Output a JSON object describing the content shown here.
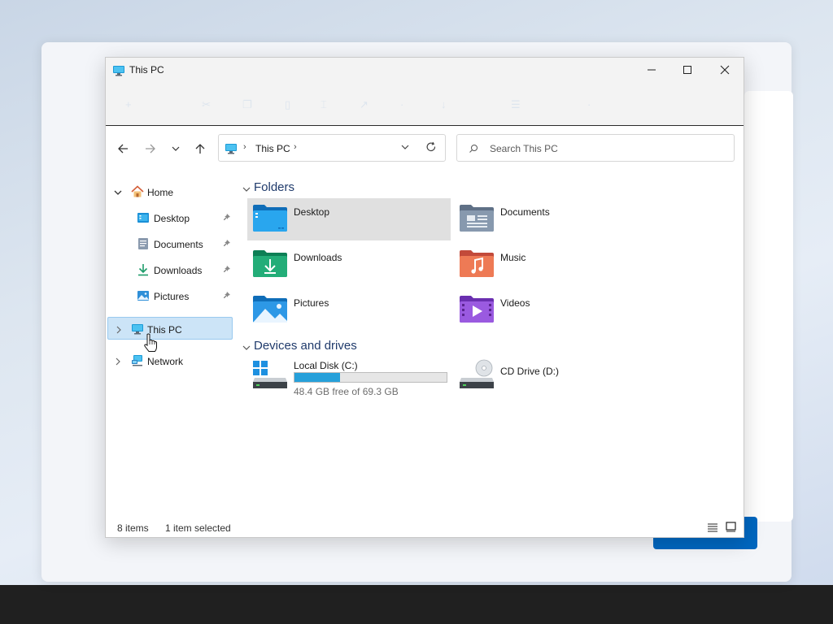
{
  "window": {
    "title": "This PC"
  },
  "address": {
    "location": "This PC",
    "separator": "›"
  },
  "search": {
    "placeholder": "Search This PC"
  },
  "sidebar": {
    "items": [
      {
        "label": "Home",
        "icon": "home-icon",
        "expanded": true
      },
      {
        "label": "Desktop",
        "icon": "desktop-folder-icon",
        "pinned": true
      },
      {
        "label": "Documents",
        "icon": "documents-folder-icon",
        "pinned": true
      },
      {
        "label": "Downloads",
        "icon": "download-arrow-icon",
        "pinned": true
      },
      {
        "label": "Pictures",
        "icon": "pictures-folder-icon",
        "pinned": true
      },
      {
        "label": "This PC",
        "icon": "computer-icon",
        "selected": true
      },
      {
        "label": "Network",
        "icon": "network-icon"
      }
    ]
  },
  "content": {
    "folders_title": "Folders",
    "folders": [
      {
        "label": "Desktop",
        "icon": "desktop-folder-icon",
        "selected": true
      },
      {
        "label": "Documents",
        "icon": "documents-folder-icon"
      },
      {
        "label": "Downloads",
        "icon": "downloads-folder-icon"
      },
      {
        "label": "Music",
        "icon": "music-folder-icon"
      },
      {
        "label": "Pictures",
        "icon": "pictures-folder-icon"
      },
      {
        "label": "Videos",
        "icon": "videos-folder-icon"
      }
    ],
    "drives_title": "Devices and drives",
    "drives": [
      {
        "label": "Local Disk (C:)",
        "free_text": "48.4 GB free of 69.3 GB",
        "used_fraction": 0.3,
        "icon": "local-disk-icon"
      },
      {
        "label": "CD Drive (D:)",
        "icon": "cd-drive-icon"
      }
    ]
  },
  "status": {
    "item_count": "8 items",
    "selection": "1 item selected"
  },
  "colors": {
    "accent": "#0067c0",
    "selection": "#cce4f7",
    "drive_bar": "#26a0da"
  }
}
